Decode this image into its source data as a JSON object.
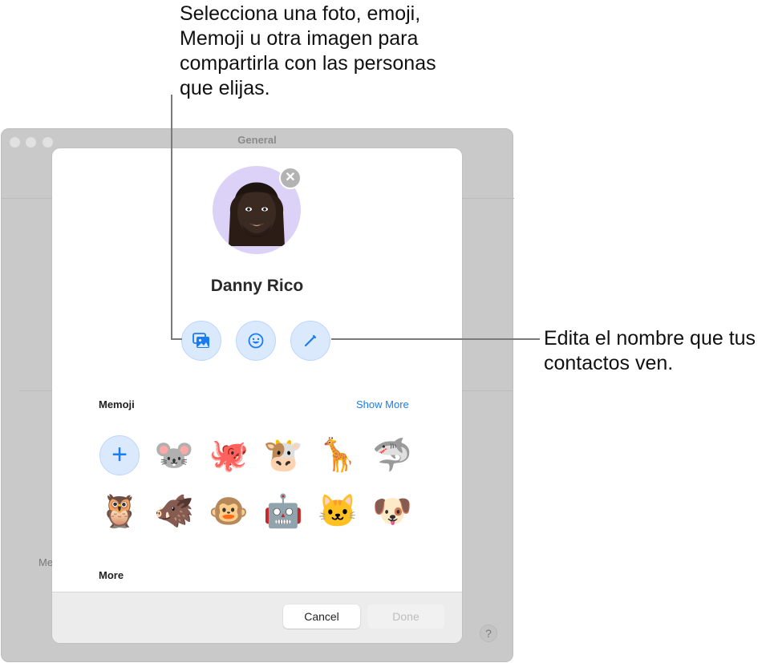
{
  "callouts": {
    "top": "Selecciona una foto, emoji, Memoji u otra imagen para compartirla con las personas que elijas.",
    "right": "Edita el nombre que tus contactos ven."
  },
  "background_window": {
    "title": "General",
    "partial_label": "Me",
    "help_label": "?"
  },
  "sheet": {
    "name": "Danny Rico",
    "avatar_icon": "memoji-avatar",
    "remove_label": "✕",
    "actions": [
      {
        "name": "photos-button",
        "icon": "photos-icon"
      },
      {
        "name": "emoji-button",
        "icon": "smiley-icon"
      },
      {
        "name": "edit-name-button",
        "icon": "pencil-icon"
      }
    ],
    "memoji_section": {
      "title": "Memoji",
      "show_more": "Show More",
      "add_label": "+",
      "items": [
        {
          "name": "mouse",
          "glyph": "🐭"
        },
        {
          "name": "octopus",
          "glyph": "🐙"
        },
        {
          "name": "cow",
          "glyph": "🐮"
        },
        {
          "name": "giraffe",
          "glyph": "🦒"
        },
        {
          "name": "shark",
          "glyph": "🦈"
        },
        {
          "name": "owl",
          "glyph": "🦉"
        },
        {
          "name": "boar",
          "glyph": "🐗"
        },
        {
          "name": "monkey",
          "glyph": "🐵"
        },
        {
          "name": "robot",
          "glyph": "🤖"
        },
        {
          "name": "cat",
          "glyph": "🐱"
        },
        {
          "name": "dog",
          "glyph": "🐶"
        }
      ]
    },
    "more_section": {
      "title": "More"
    },
    "footer": {
      "cancel": "Cancel",
      "done": "Done"
    }
  },
  "colors": {
    "accent": "#1a7cf0",
    "action_bg": "#dbe9fd",
    "avatar_bg": "#dcd2f7"
  }
}
